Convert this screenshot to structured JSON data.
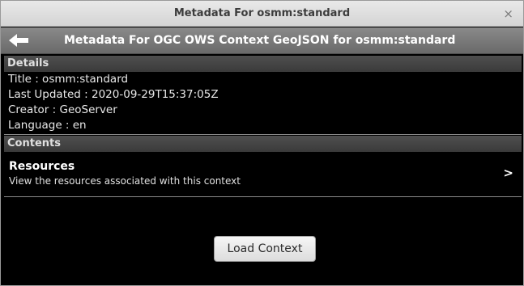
{
  "window": {
    "title": "Metadata For osmm:standard",
    "close_glyph": "×"
  },
  "header": {
    "title": "Metadata For OGC OWS Context GeoJSON for osmm:standard",
    "back_icon": "back-arrow-icon"
  },
  "details": {
    "label": "Details",
    "lines": [
      "Title : osmm:standard",
      "Last Updated : 2020-09-29T15:37:05Z",
      "Creator : GeoServer",
      "Language : en"
    ]
  },
  "contents": {
    "label": "Contents",
    "resources": {
      "title": "Resources",
      "subtitle": "View the resources associated with this context",
      "chevron": ">"
    }
  },
  "actions": {
    "load_label": "Load Context"
  }
}
